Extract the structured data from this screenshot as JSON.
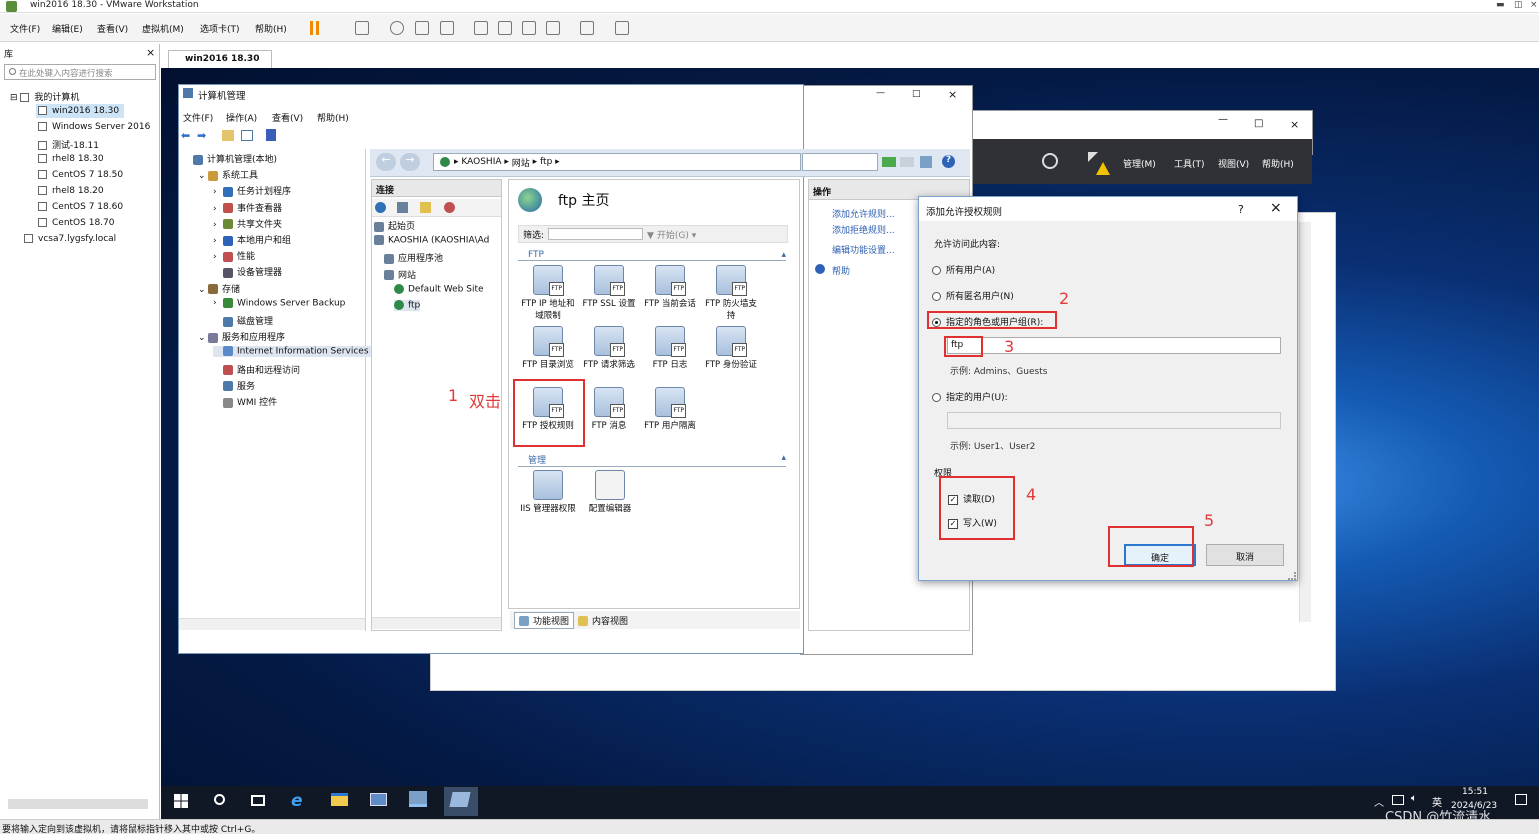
{
  "vmware": {
    "title": "win2016 18.30 - VMware Workstation",
    "menu": [
      "文件(F)",
      "编辑(E)",
      "查看(V)",
      "虚拟机(M)",
      "选项卡(T)",
      "帮助(H)"
    ],
    "library": {
      "header": "库",
      "close": "×",
      "search_placeholder": "在此处键入内容进行搜索",
      "root": "我的计算机",
      "items": [
        "win2016 18.30",
        "Windows Server 2016",
        "测试-18.11",
        "rhel8 18.30",
        "CentOS 7  18.50",
        "rhel8 18.20",
        "CentOS 7 18.60",
        "CentOS 18.70"
      ],
      "extra": "vcsa7.lygsfy.local"
    },
    "tab": "win2016 18.30",
    "status": "要将输入定向到该虚拟机，请将鼠标指针移入其中或按 Ctrl+G。"
  },
  "cm": {
    "title": "计算机管理",
    "menu": [
      "文件(F)",
      "操作(A)",
      "查看(V)",
      "帮助(H)"
    ],
    "tree": [
      {
        "t": "计算机管理(本地)",
        "l": 0
      },
      {
        "t": "系统工具",
        "l": 1
      },
      {
        "t": "任务计划程序",
        "l": 2
      },
      {
        "t": "事件查看器",
        "l": 2
      },
      {
        "t": "共享文件夹",
        "l": 2
      },
      {
        "t": "本地用户和组",
        "l": 2
      },
      {
        "t": "性能",
        "l": 2
      },
      {
        "t": "设备管理器",
        "l": 2
      },
      {
        "t": "存储",
        "l": 1
      },
      {
        "t": "Windows Server Backup",
        "l": 2
      },
      {
        "t": "磁盘管理",
        "l": 2
      },
      {
        "t": "服务和应用程序",
        "l": 1
      },
      {
        "t": "Internet Information Services",
        "l": 2
      },
      {
        "t": "路由和远程访问",
        "l": 2
      },
      {
        "t": "服务",
        "l": 2
      },
      {
        "t": "WMI 控件",
        "l": 2
      }
    ]
  },
  "iis": {
    "breadcrumb": [
      "KAOSHIA",
      "网站",
      "ftp"
    ],
    "conn_header": "连接",
    "conn_tree": [
      {
        "t": "起始页",
        "l": 0
      },
      {
        "t": "KAOSHIA (KAOSHIA\\Ad",
        "l": 0
      },
      {
        "t": "应用程序池",
        "l": 1
      },
      {
        "t": "网站",
        "l": 1
      },
      {
        "t": "Default Web Site",
        "l": 2
      },
      {
        "t": "ftp",
        "l": 2
      }
    ],
    "home_title": "ftp 主页",
    "filter_label": "筛选:",
    "start_label": "开始(G)",
    "group_ftp": "FTP",
    "group_manage": "管理",
    "features": [
      "FTP IP 地址和域限制",
      "FTP SSL 设置",
      "FTP 当前会话",
      "FTP 防火墙支持",
      "FTP 目录浏览",
      "FTP 请求筛选",
      "FTP 日志",
      "FTP 身份验证",
      "FTP 授权规则",
      "FTP 消息",
      "FTP 用户隔离"
    ],
    "manage_features": [
      "IIS 管理器权限",
      "配置编辑器"
    ],
    "view_tabs": [
      "功能视图",
      "内容视图"
    ],
    "actions_header": "操作",
    "actions": [
      "添加允许规则...",
      "添加拒绝规则...",
      "编辑功能设置..."
    ],
    "help": "帮助"
  },
  "server_mgr": {
    "menu": [
      "管理(M)",
      "工具(T)",
      "视图(V)",
      "帮助(H)"
    ]
  },
  "dialog": {
    "title": "添加允许授权规则",
    "question": "?",
    "allow_label": "允许访问此内容:",
    "opt_all": "所有用户(A)",
    "opt_anon": "所有匿名用户(N)",
    "opt_roles": "指定的角色或用户组(R):",
    "roles_value": "ftp",
    "roles_example": "示例: Admins、Guests",
    "opt_users": "指定的用户(U):",
    "users_example": "示例: User1、User2",
    "perm_label": "权限",
    "read": "读取(D)",
    "write": "写入(W)",
    "ok": "确定",
    "cancel": "取消"
  },
  "annotations": {
    "n1": "1",
    "dbl": "双击",
    "n2": "2",
    "n3": "3",
    "n4": "4",
    "n5": "5"
  },
  "taskbar": {
    "time": "15:51",
    "date": "2024/6/23",
    "lang": "英"
  },
  "watermark": "CSDN @竹流清水"
}
